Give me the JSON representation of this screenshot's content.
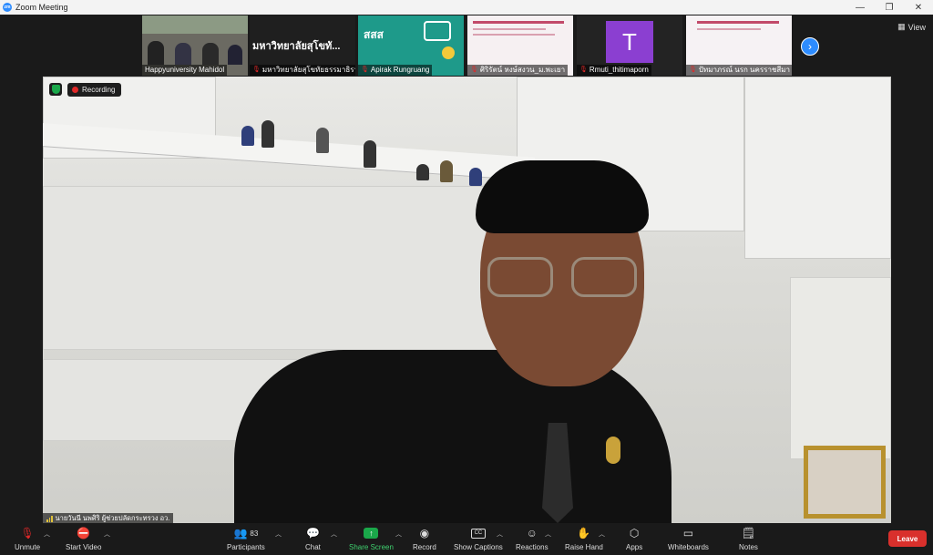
{
  "window": {
    "title": "Zoom Meeting",
    "minimize": "—",
    "maximize": "❐",
    "close": "✕"
  },
  "gallery": {
    "view_label": "View",
    "participants": [
      {
        "name": "Happyuniversity Mahidol",
        "muted": false,
        "kind": "video"
      },
      {
        "name": "มหาวิทยาลัยสุโขทัยธรรมาธิราช",
        "muted": true,
        "kind": "title",
        "display_text": "มหาวิทยาลัยสุโขทั..."
      },
      {
        "name": "Apirak Rungruang",
        "muted": true,
        "kind": "logo",
        "logo_text": "สสส"
      },
      {
        "name": "ศิริรัตน์ หงษ์สงวน_ม.พะเยา",
        "muted": true,
        "kind": "slides"
      },
      {
        "name": "Rmuti_thitimaporn",
        "muted": true,
        "kind": "avatar",
        "initial": "T"
      },
      {
        "name": "ปัทมาภรณ์ นรก นครราชสีมา",
        "muted": true,
        "kind": "slides"
      }
    ]
  },
  "main_video": {
    "recording_label": "Recording",
    "speaker_name": "นายวันนี นพศิริ ผู้ช่วยปลัดกระทรวง อว."
  },
  "toolbar": {
    "unmute": "Unmute",
    "start_video": "Start Video",
    "participants": "Participants",
    "participants_count": "83",
    "chat": "Chat",
    "share_screen": "Share Screen",
    "record": "Record",
    "show_captions": "Show Captions",
    "reactions": "Reactions",
    "raise_hand": "Raise Hand",
    "apps": "Apps",
    "whiteboards": "Whiteboards",
    "notes": "Notes",
    "leave": "Leave"
  },
  "colors": {
    "accent": "#2d8cff",
    "share_green": "#1aa84a",
    "leave_red": "#d9302c",
    "muted_red": "#e02828"
  }
}
